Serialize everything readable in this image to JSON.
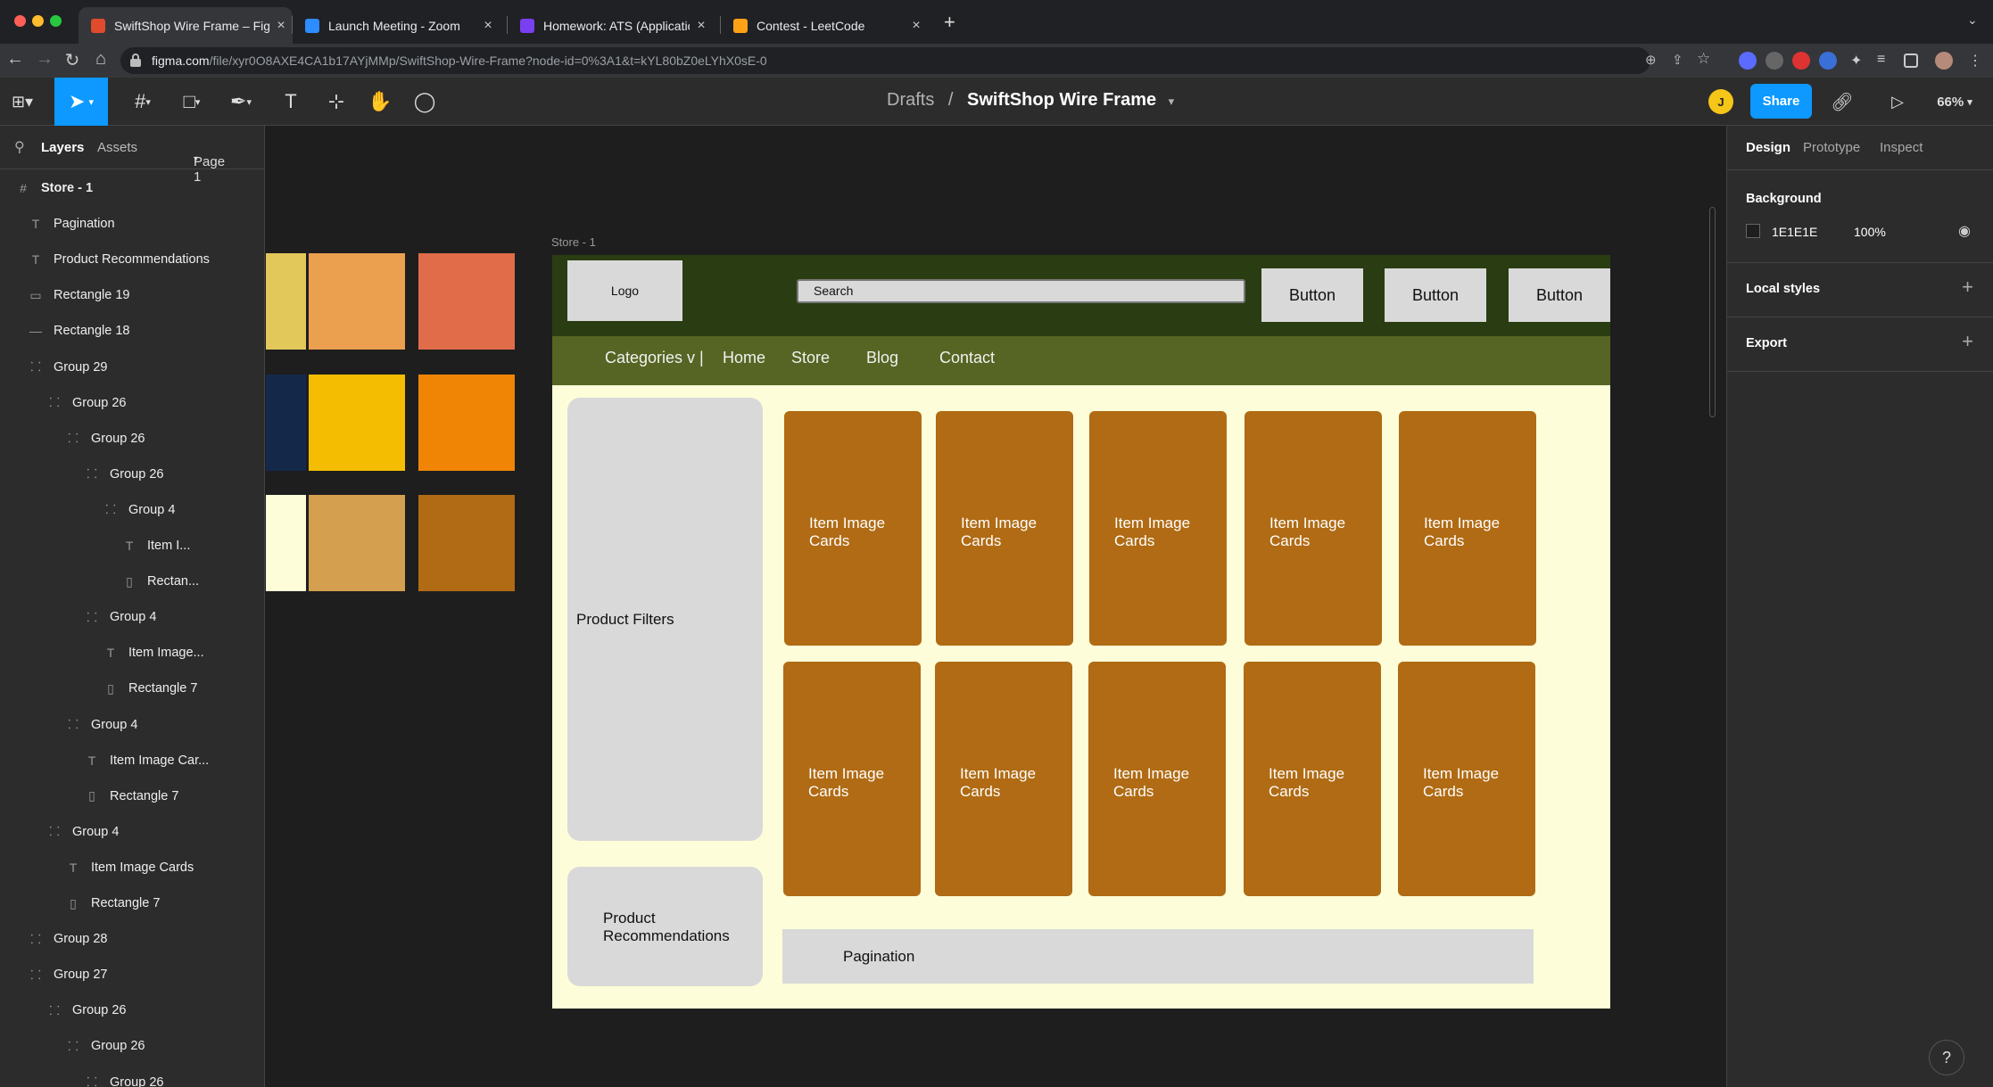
{
  "browser": {
    "tabs": [
      {
        "title": "SwiftShop Wire Frame – Figma",
        "favicon_color": "#e04b2e"
      },
      {
        "title": "Launch Meeting - Zoom",
        "favicon_color": "#2d8cff"
      },
      {
        "title": "Homework: ATS (Application Tr",
        "favicon_color": "#7b3ff2"
      },
      {
        "title": "Contest - LeetCode",
        "favicon_color": "#ffa116"
      }
    ],
    "new_tab": "+",
    "url_host": "figma.com",
    "url_path": "/file/xyr0O8AXE4CA1b17AYjMMp/SwiftShop-Wire-Frame?node-id=0%3A1&t=kYL80bZ0eLYhX0sE-0"
  },
  "toolbar": {
    "breadcrumb_parent": "Drafts",
    "breadcrumb_sep": "/",
    "file_name": "SwiftShop Wire Frame",
    "avatar_initial": "J",
    "share_label": "Share",
    "zoom": "66%"
  },
  "left_panel": {
    "tab_layers": "Layers",
    "tab_assets": "Assets",
    "page": "Page 1",
    "layers": [
      {
        "name": "Store - 1",
        "icon": "#",
        "indent": 0,
        "bold": true
      },
      {
        "name": "Pagination",
        "icon": "T",
        "indent": 1
      },
      {
        "name": "Product Recommendations",
        "icon": "T",
        "indent": 1
      },
      {
        "name": "Rectangle 19",
        "icon": "▭",
        "indent": 1
      },
      {
        "name": "Rectangle 18",
        "icon": "—",
        "indent": 1
      },
      {
        "name": "Group 29",
        "icon": "⸬",
        "indent": 1
      },
      {
        "name": "Group 26",
        "icon": "⸬",
        "indent": 2
      },
      {
        "name": "Group 26",
        "icon": "⸬",
        "indent": 3
      },
      {
        "name": "Group 26",
        "icon": "⸬",
        "indent": 4
      },
      {
        "name": "Group 4",
        "icon": "⸬",
        "indent": 5
      },
      {
        "name": "Item I...",
        "icon": "T",
        "indent": 6
      },
      {
        "name": "Rectan...",
        "icon": "▯",
        "indent": 6
      },
      {
        "name": "Group 4",
        "icon": "⸬",
        "indent": 4
      },
      {
        "name": "Item Image...",
        "icon": "T",
        "indent": 5
      },
      {
        "name": "Rectangle 7",
        "icon": "▯",
        "indent": 5
      },
      {
        "name": "Group 4",
        "icon": "⸬",
        "indent": 3
      },
      {
        "name": "Item Image Car...",
        "icon": "T",
        "indent": 4
      },
      {
        "name": "Rectangle 7",
        "icon": "▯",
        "indent": 4
      },
      {
        "name": "Group 4",
        "icon": "⸬",
        "indent": 2
      },
      {
        "name": "Item Image Cards",
        "icon": "T",
        "indent": 3
      },
      {
        "name": "Rectangle 7",
        "icon": "▯",
        "indent": 3
      },
      {
        "name": "Group 28",
        "icon": "⸬",
        "indent": 1
      },
      {
        "name": "Group 27",
        "icon": "⸬",
        "indent": 1
      },
      {
        "name": "Group 26",
        "icon": "⸬",
        "indent": 2
      },
      {
        "name": "Group 26",
        "icon": "⸬",
        "indent": 3
      },
      {
        "name": "Group 26",
        "icon": "⸬",
        "indent": 4
      }
    ]
  },
  "right_panel": {
    "tabs": [
      "Design",
      "Prototype",
      "Inspect"
    ],
    "background_label": "Background",
    "background_hex": "1E1E1E",
    "background_opacity": "100%",
    "local_styles": "Local styles",
    "export": "Export"
  },
  "canvas": {
    "swatches": [
      "#e2c75a",
      "#eba050",
      "#e06c4a",
      "#14294a",
      "#f5bd02",
      "#f08505",
      "#fdfdd9",
      "#d49f4e",
      "#b06b14"
    ],
    "frame_label": "Store - 1",
    "wire": {
      "logo": "Logo",
      "search": "Search",
      "buttons": [
        "Button",
        "Button",
        "Button"
      ],
      "nav": [
        "Categories v |",
        "Home",
        "Store",
        "Blog",
        "Contact"
      ],
      "filters": "Product Filters",
      "recommendations": "Product Recommendations",
      "card_label": "Item Image Cards",
      "pagination": "Pagination"
    }
  },
  "help": "?"
}
